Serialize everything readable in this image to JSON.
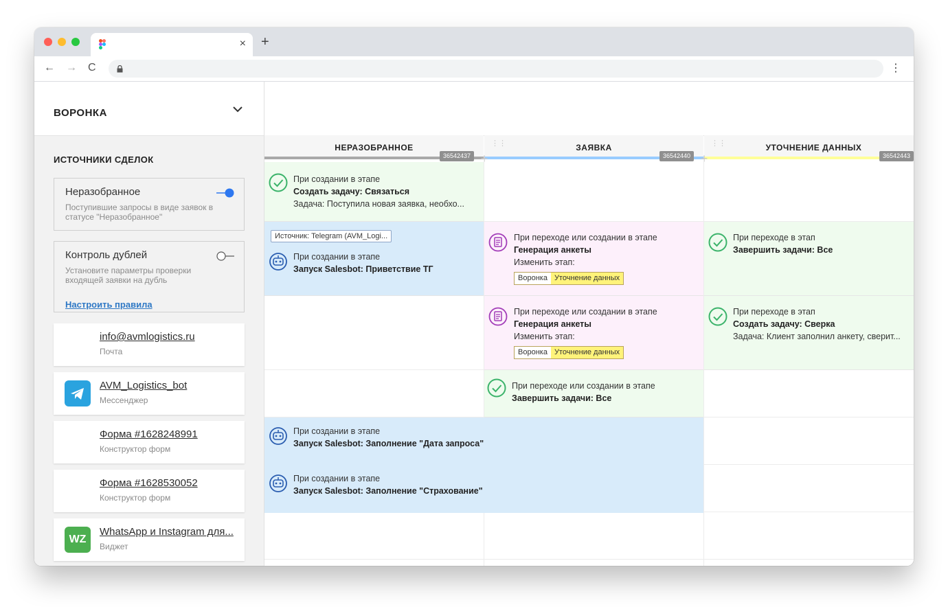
{
  "browser": {
    "tab_title": "",
    "tab_close": "×",
    "new_tab": "+",
    "back": "←",
    "forward": "→",
    "reload": "C",
    "menu": "⋮"
  },
  "sidebar": {
    "title": "ВОРОНКА",
    "section_title": "ИСТОЧНИКИ СДЕЛОК",
    "cards": [
      {
        "title": "Неразобранное",
        "desc": "Поступившие запросы в виде заявок в статусе \"Неразобранное\"",
        "enabled": true
      },
      {
        "title": "Контроль дублей",
        "desc": "Установите параметры проверки входящей заявки на дубль",
        "enabled": false,
        "link": "Настроить правила"
      }
    ],
    "sources": [
      {
        "title": "info@avmlogistics.ru",
        "sub": "Почта",
        "icon": "none"
      },
      {
        "title": "AVM_Logistics_bot",
        "sub": "Мессенджер",
        "icon": "telegram-icon"
      },
      {
        "title": "Форма #1628248991",
        "sub": "Конструктор форм",
        "icon": "none"
      },
      {
        "title": "Форма #1628530052",
        "sub": "Конструктор форм",
        "icon": "none"
      },
      {
        "title": "WhatsApp и Instagram для...",
        "sub": "Виджет",
        "icon": "wz-icon",
        "icon_text": "WZ"
      }
    ]
  },
  "columns": [
    {
      "title": "НЕРАЗОБРАННОЕ",
      "id": "36542437",
      "color": "#a9a9a9"
    },
    {
      "title": "ЗАЯВКА",
      "id": "36542440",
      "color": "#99ccff"
    },
    {
      "title": "УТОЧНЕНИЕ ДАННЫХ",
      "id": "36542443",
      "color": "#ffff99"
    }
  ],
  "cells": {
    "c1r1": {
      "trigger": "При создании в этапе",
      "action": "Создать задачу: Связаться",
      "detail": "Задача: Поступила новая заявка, необхо..."
    },
    "c1r2": {
      "tag": "Источник: Telegram (AVM_Logi...",
      "trigger": "При создании в этапе",
      "action": "Запуск Salesbot: Приветствие ТГ"
    },
    "c2r2": {
      "trigger": "При переходе или создании в этапе",
      "action": "Генерация анкеты",
      "detail": "Изменить этап:",
      "stage_a": "Воронка",
      "stage_b": "Уточнение данных"
    },
    "c3r2": {
      "trigger": "При переходе в этап",
      "action": "Завершить задачи: Все"
    },
    "c2r3": {
      "trigger": "При переходе или создании в этапе",
      "action": "Генерация анкеты",
      "detail": "Изменить этап:",
      "stage_a": "Воронка",
      "stage_b": "Уточнение данных"
    },
    "c3r3": {
      "trigger": "При переходе в этап",
      "action": "Создать задачу: Сверка",
      "detail": "Задача: Клиент заполнил анкету, сверит..."
    },
    "c2r4": {
      "trigger": "При переходе или создании в этапе",
      "action": "Завершить задачи: Все"
    },
    "wide1": {
      "trigger": "При создании в этапе",
      "action": "Запуск Salesbot: Заполнение \"Дата запроса\""
    },
    "wide2": {
      "trigger": "При создании в этапе",
      "action": "Запуск Salesbot: Заполнение \"Страхование\""
    }
  },
  "colors": {
    "green_cell": "#effbee",
    "blue_cell": "#d8ebfa",
    "pink_cell": "#fdf0fb",
    "toggle_on": "#2e78f0",
    "link": "#2e78c5"
  }
}
